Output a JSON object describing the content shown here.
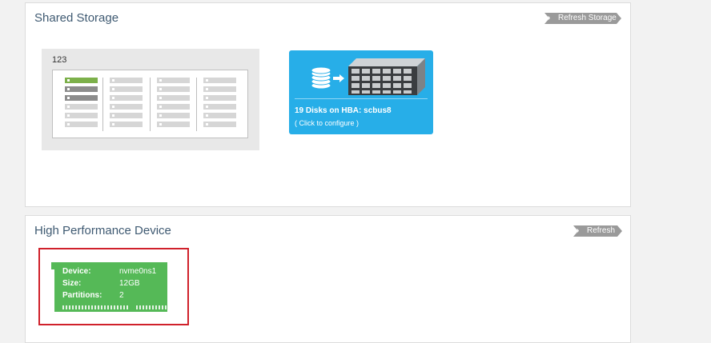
{
  "shared_storage": {
    "title": "Shared Storage",
    "refresh_label": "Refresh Storage",
    "pool": {
      "name": "123"
    },
    "hba_tile": {
      "title": "19 Disks on HBA: scbus8",
      "subtitle": "( Click to configure )"
    }
  },
  "high_performance": {
    "title": "High Performance Device",
    "refresh_label": "Refresh",
    "device": {
      "device_label": "Device:",
      "device_value": "nvme0ns1",
      "size_label": "Size:",
      "size_value": "12GB",
      "partitions_label": "Partitions:",
      "partitions_value": "2"
    }
  },
  "colors": {
    "hba_tile": "#27aee8",
    "nvme_card": "#55b957",
    "highlight_border": "#d0212b",
    "pool_disk_used": "#7cb04a"
  }
}
